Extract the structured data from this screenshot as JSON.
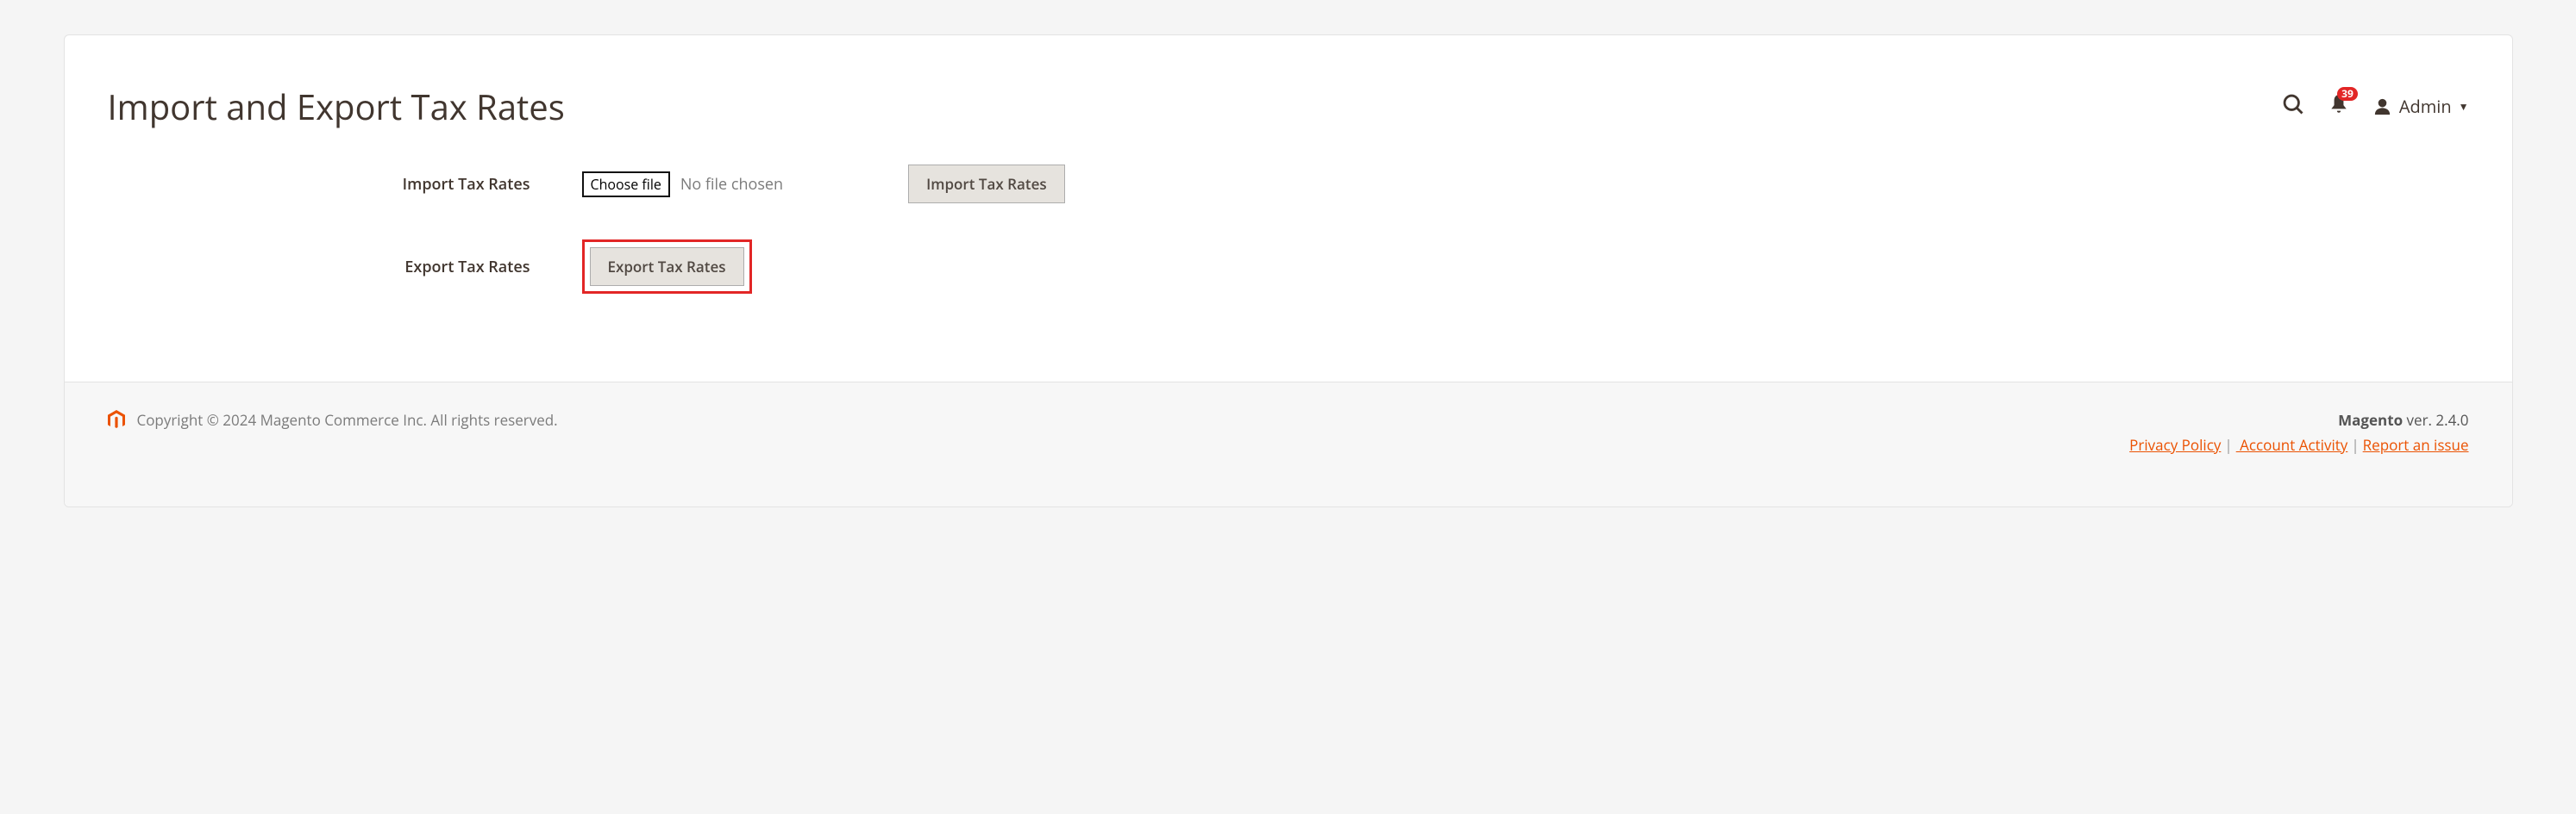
{
  "page": {
    "title": "Import and Export Tax Rates"
  },
  "header": {
    "notificationCount": "39",
    "adminLabel": "Admin"
  },
  "form": {
    "importLabel": "Import Tax Rates",
    "chooseFileLabel": "Choose file",
    "fileStatus": "No file chosen",
    "importButton": "Import Tax Rates",
    "exportLabel": "Export Tax Rates",
    "exportButton": "Export Tax Rates"
  },
  "footer": {
    "copyright": "Copyright © 2024 Magento Commerce Inc. All rights reserved.",
    "brand": "Magento",
    "versionText": " ver. 2.4.0",
    "links": {
      "privacy": "Privacy Policy",
      "activity": " Account Activity",
      "report": "Report an issue"
    }
  }
}
